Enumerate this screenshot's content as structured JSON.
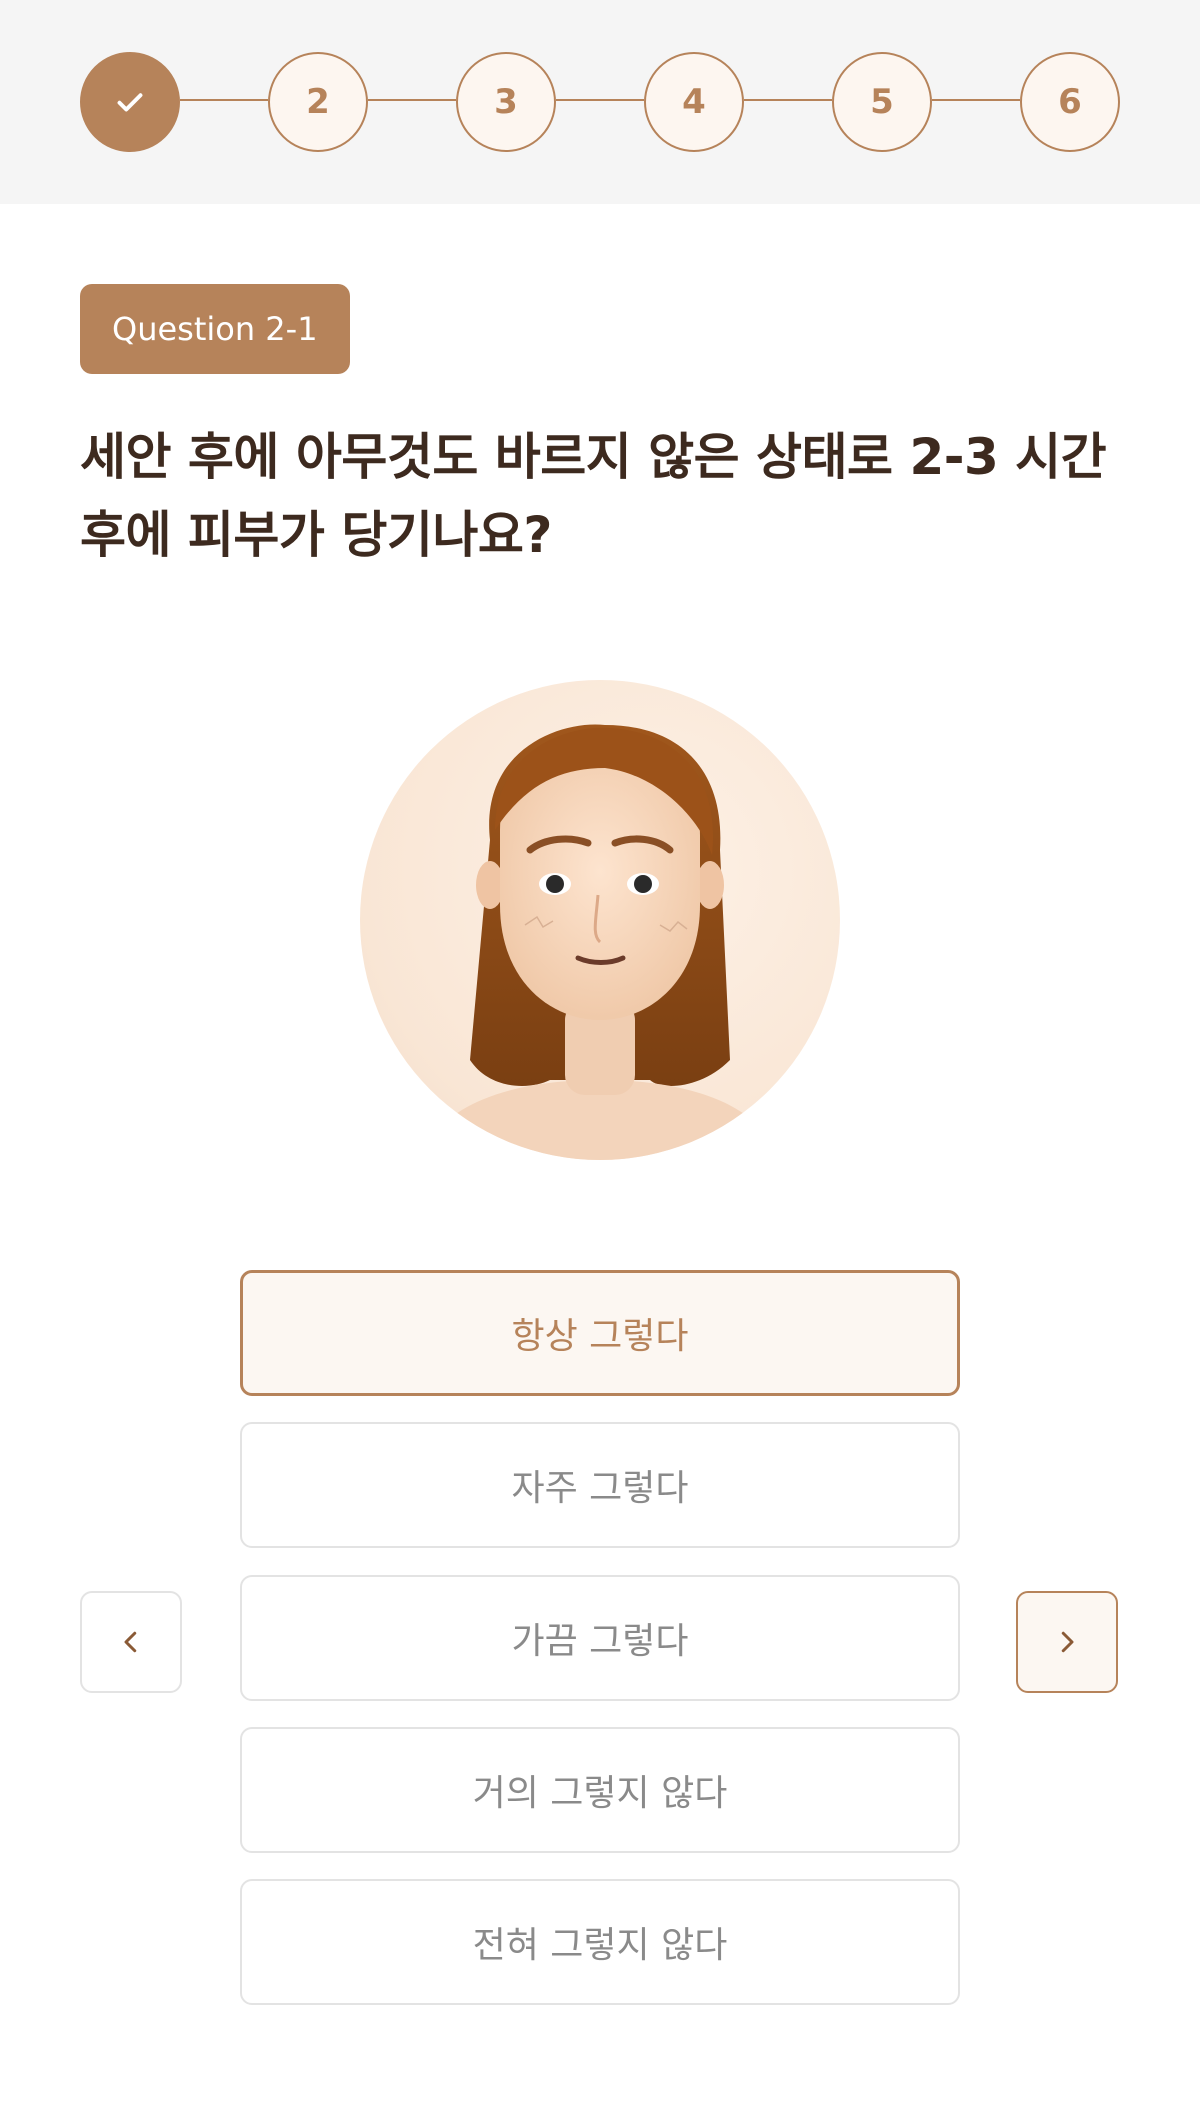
{
  "stepper": {
    "steps": [
      {
        "label": "",
        "state": "done"
      },
      {
        "label": "2",
        "state": "pending"
      },
      {
        "label": "3",
        "state": "pending"
      },
      {
        "label": "4",
        "state": "pending"
      },
      {
        "label": "5",
        "state": "pending"
      },
      {
        "label": "6",
        "state": "pending"
      }
    ],
    "done_icon": "checkmark-icon"
  },
  "question": {
    "badge": "Question 2-1",
    "text_line1": "세안 후에 아무것도 바르지 않은 상태로 2-3 시간",
    "text_line2": "후에 피부가 당기나요?"
  },
  "illustration": {
    "icon": "avatar-face-icon"
  },
  "options": [
    {
      "label": "항상 그렇다",
      "selected": true
    },
    {
      "label": "자주 그렇다",
      "selected": false
    },
    {
      "label": "가끔 그렇다",
      "selected": false
    },
    {
      "label": "거의 그렇지 않다",
      "selected": false
    },
    {
      "label": "전혀 그렇지 않다",
      "selected": false
    }
  ],
  "nav": {
    "prev_icon": "chevron-left-icon",
    "next_icon": "chevron-right-icon"
  },
  "colors": {
    "accent": "#b6835a",
    "header_bg": "#f5f5f5",
    "text_dark": "#3d2a1f",
    "option_text": "#8a8a8a",
    "option_border": "#e3e3e3",
    "selected_bg": "#fcf7f2"
  }
}
